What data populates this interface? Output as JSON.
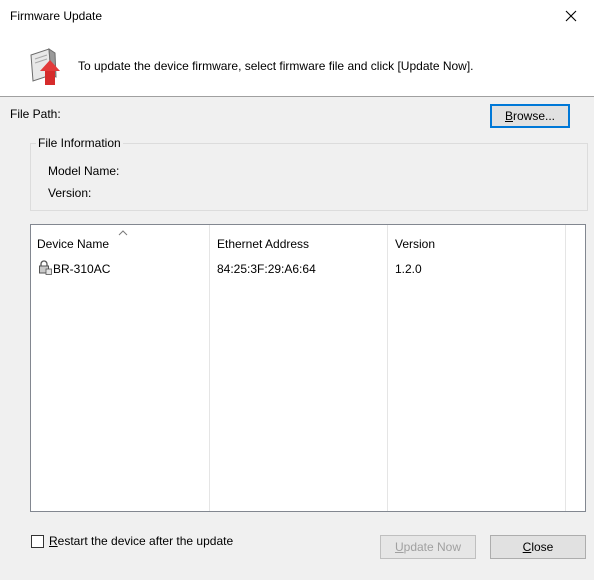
{
  "window": {
    "title": "Firmware Update"
  },
  "header": {
    "instruction": "To update the device firmware, select firmware file and click [Update Now]."
  },
  "file": {
    "path_label": "File Path:",
    "browse_mnemonic": "B",
    "browse_rest": "rowse..."
  },
  "file_info": {
    "legend": "File Information",
    "model_label": "Model Name:",
    "version_label": "Version:"
  },
  "device_list": {
    "columns": [
      "Device Name",
      "Ethernet Address",
      "Version"
    ],
    "rows": [
      {
        "name": "BR-310AC",
        "ethernet": "84:25:3F:29:A6:64",
        "version": "1.2.0"
      }
    ]
  },
  "footer": {
    "restart_mnemonic": "R",
    "restart_rest": "estart the device after the update",
    "restart_checked": false,
    "update_mnemonic": "U",
    "update_rest": "pdate Now",
    "close_mnemonic": "C",
    "close_rest": "lose"
  }
}
